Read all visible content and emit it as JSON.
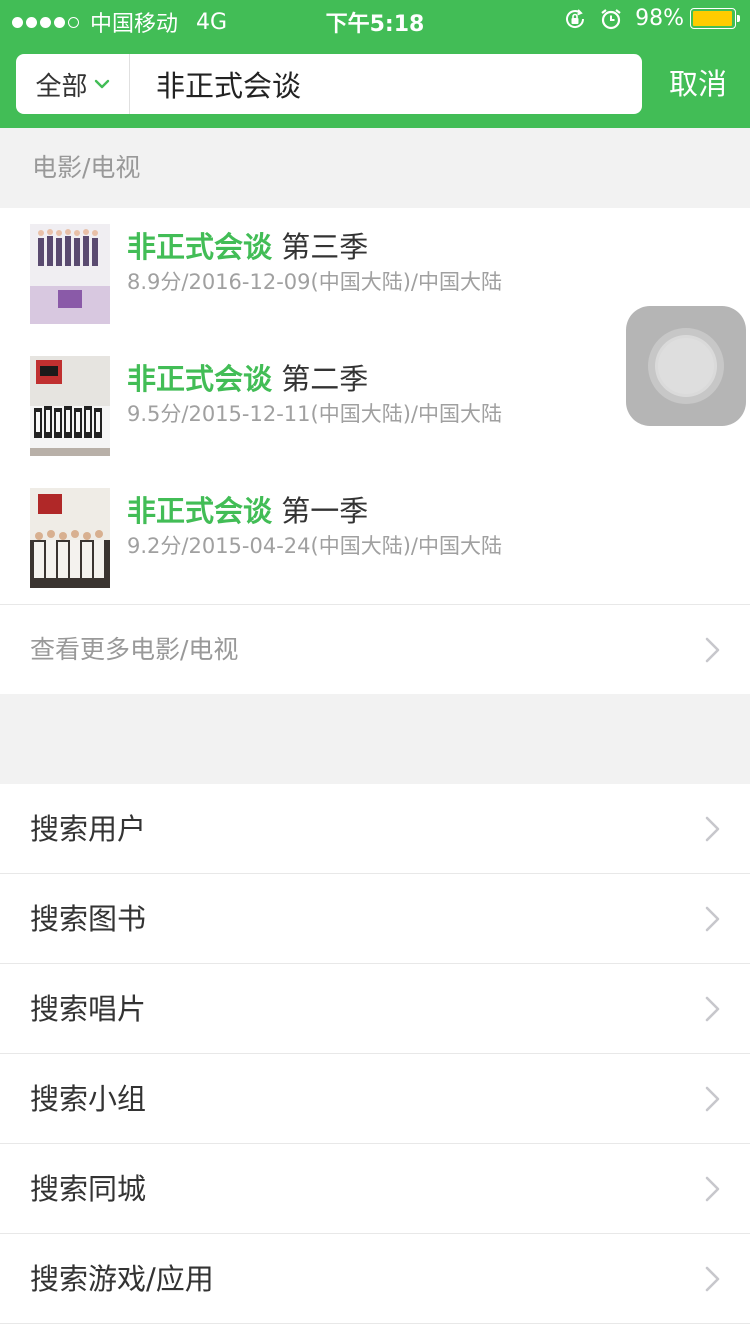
{
  "status_bar": {
    "carrier": "中国移动",
    "network": "4G",
    "time": "下午5:18",
    "battery": "98%",
    "battery_level": 0.98,
    "signal_bars": 4
  },
  "search": {
    "scope": "全部",
    "query": "非正式会谈",
    "cancel": "取消"
  },
  "section": {
    "title": "电影/电视"
  },
  "results": [
    {
      "highlight": "非正式会谈",
      "suffix": " 第三季",
      "meta": "8.9分/2016-12-09(中国大陆)/中国大陆"
    },
    {
      "highlight": "非正式会谈",
      "suffix": " 第二季",
      "meta": "9.5分/2015-12-11(中国大陆)/中国大陆"
    },
    {
      "highlight": "非正式会谈",
      "suffix": " 第一季",
      "meta": "9.2分/2015-04-24(中国大陆)/中国大陆"
    }
  ],
  "more": "查看更多电影/电视",
  "search_options": [
    "搜索用户",
    "搜索图书",
    "搜索唱片",
    "搜索小组",
    "搜索同城",
    "搜索游戏/应用"
  ],
  "colors": {
    "accent": "#42bd56",
    "battery": "#ffcc00"
  }
}
